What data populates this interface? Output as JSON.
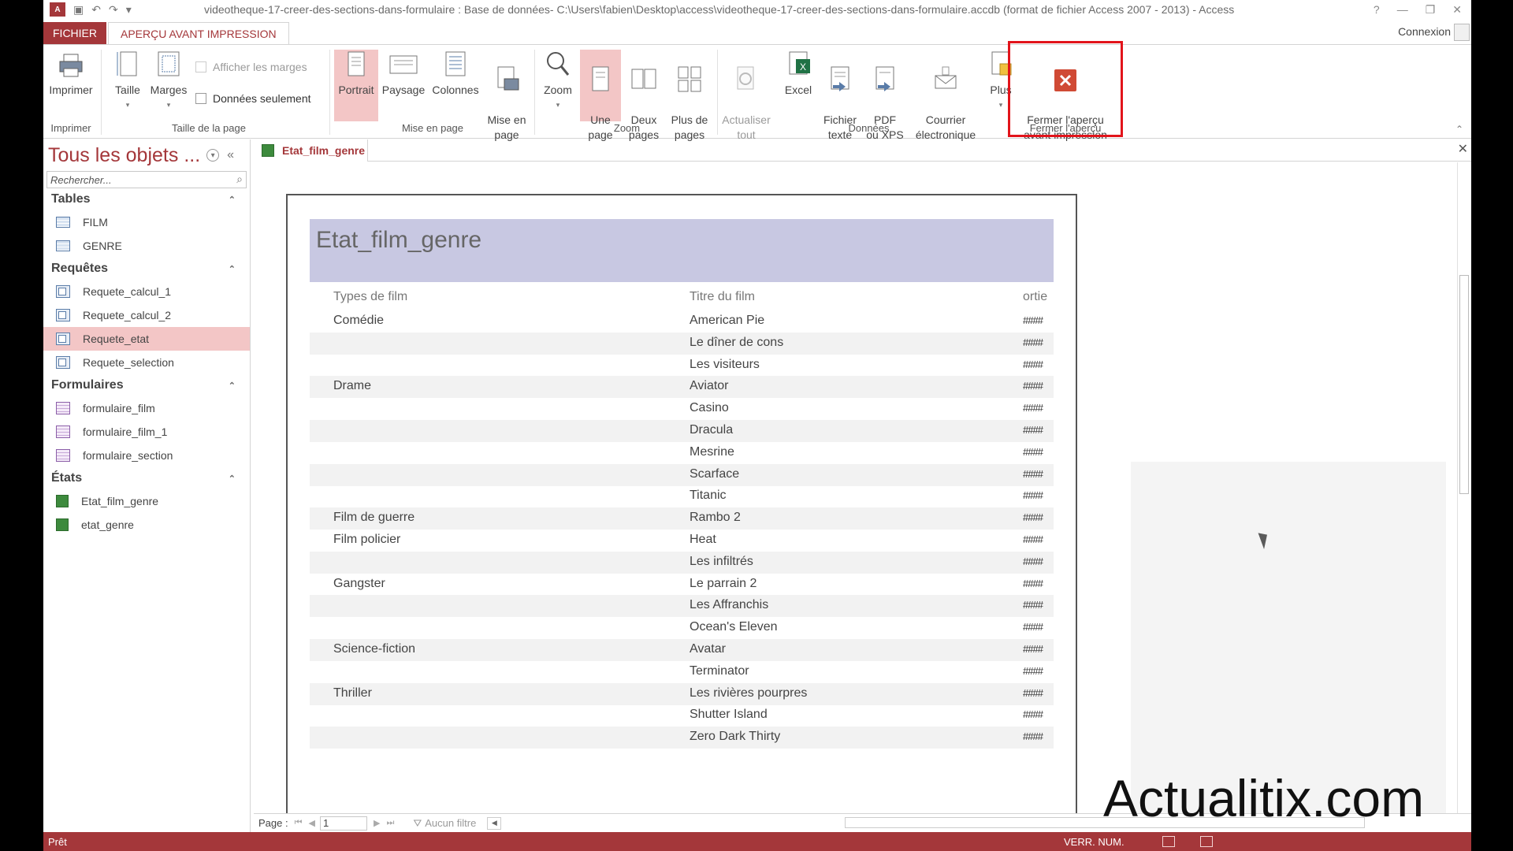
{
  "app": {
    "logo_text": "A",
    "title": "videotheque-17-creer-des-sections-dans-formulaire : Base de données- C:\\Users\\fabien\\Desktop\\access\\videotheque-17-creer-des-sections-dans-formulaire.accdb (format de fichier Access 2007 - 2013) - Access",
    "help": "?",
    "minimize": "—",
    "restore": "❐",
    "close": "✕"
  },
  "tabs": {
    "file": "FICHIER",
    "active": "APERÇU AVANT IMPRESSION",
    "connexion": "Connexion"
  },
  "ribbon": {
    "imprimer": "Imprimer",
    "taille": "Taille",
    "marges": "Marges",
    "afficher_marges": "Afficher les marges",
    "donnees_seulement": "Données seulement",
    "portrait": "Portrait",
    "paysage": "Paysage",
    "colonnes": "Colonnes",
    "mise_en_page": "Mise en\npage",
    "zoom": "Zoom",
    "une_page": "Une\npage",
    "deux_pages": "Deux\npages",
    "plus_de_pages": "Plus de\npages",
    "actualiser": "Actualiser\ntout",
    "excel": "Excel",
    "fichier_texte": "Fichier\ntexte",
    "pdf": "PDF\nou XPS",
    "courrier": "Courrier\nélectronique",
    "plus": "Plus",
    "fermer": "Fermer l'aperçu\navant impression",
    "groups": {
      "imprimer": "Imprimer",
      "taille_page": "Taille de la page",
      "mise_en_page": "Mise en page",
      "zoom": "Zoom",
      "donnees": "Données",
      "fermer": "Fermer l'aperçu"
    }
  },
  "nav": {
    "header": "Tous les objets ...",
    "search_placeholder": "Rechercher...",
    "sections": [
      {
        "title": "Tables",
        "items": [
          "FILM",
          "GENRE"
        ]
      },
      {
        "title": "Requêtes",
        "items": [
          "Requete_calcul_1",
          "Requete_calcul_2",
          "Requete_etat",
          "Requete_selection"
        ]
      },
      {
        "title": "Formulaires",
        "items": [
          "formulaire_film",
          "formulaire_film_1",
          "formulaire_section"
        ]
      },
      {
        "title": "États",
        "items": [
          "Etat_film_genre",
          "etat_genre"
        ]
      }
    ],
    "active_item": "Requete_etat"
  },
  "document": {
    "tab_label": "Etat_film_genre",
    "report_title": "Etat_film_genre",
    "col_headers": [
      "Types de film",
      "Titre du film",
      "ortie"
    ],
    "rows": [
      {
        "genre": "Comédie",
        "title": "American Pie",
        "value": "####"
      },
      {
        "genre": "",
        "title": "Le dîner de cons",
        "value": "####"
      },
      {
        "genre": "",
        "title": "Les visiteurs",
        "value": "####"
      },
      {
        "genre": "Drame",
        "title": "Aviator",
        "value": "####"
      },
      {
        "genre": "",
        "title": "Casino",
        "value": "####"
      },
      {
        "genre": "",
        "title": "Dracula",
        "value": "####"
      },
      {
        "genre": "",
        "title": "Mesrine",
        "value": "####"
      },
      {
        "genre": "",
        "title": "Scarface",
        "value": "####"
      },
      {
        "genre": "",
        "title": "Titanic",
        "value": "####"
      },
      {
        "genre": "Film de guerre",
        "title": "Rambo 2",
        "value": "####"
      },
      {
        "genre": "Film policier",
        "title": "Heat",
        "value": "####"
      },
      {
        "genre": "",
        "title": "Les infiltrés",
        "value": "####"
      },
      {
        "genre": "Gangster",
        "title": "Le parrain 2",
        "value": "####"
      },
      {
        "genre": "",
        "title": "Les Affranchis",
        "value": "####"
      },
      {
        "genre": "",
        "title": "Ocean's Eleven",
        "value": "####"
      },
      {
        "genre": "Science-fiction",
        "title": "Avatar",
        "value": "####"
      },
      {
        "genre": "",
        "title": "Terminator",
        "value": "####"
      },
      {
        "genre": "Thriller",
        "title": "Les rivières pourpres",
        "value": "####"
      },
      {
        "genre": "",
        "title": "Shutter Island",
        "value": "####"
      },
      {
        "genre": "",
        "title": "Zero Dark Thirty",
        "value": "####"
      }
    ]
  },
  "recnav": {
    "page_label": "Page :",
    "page_value": "1",
    "filter": "Aucun filtre"
  },
  "status": {
    "ready": "Prêt",
    "numlock": "VERR. NUM."
  },
  "watermark": "Actualitix.com",
  "colors": {
    "accent": "#a4373a",
    "highlight": "#e2141b",
    "title_band": "#c8c8e2"
  }
}
